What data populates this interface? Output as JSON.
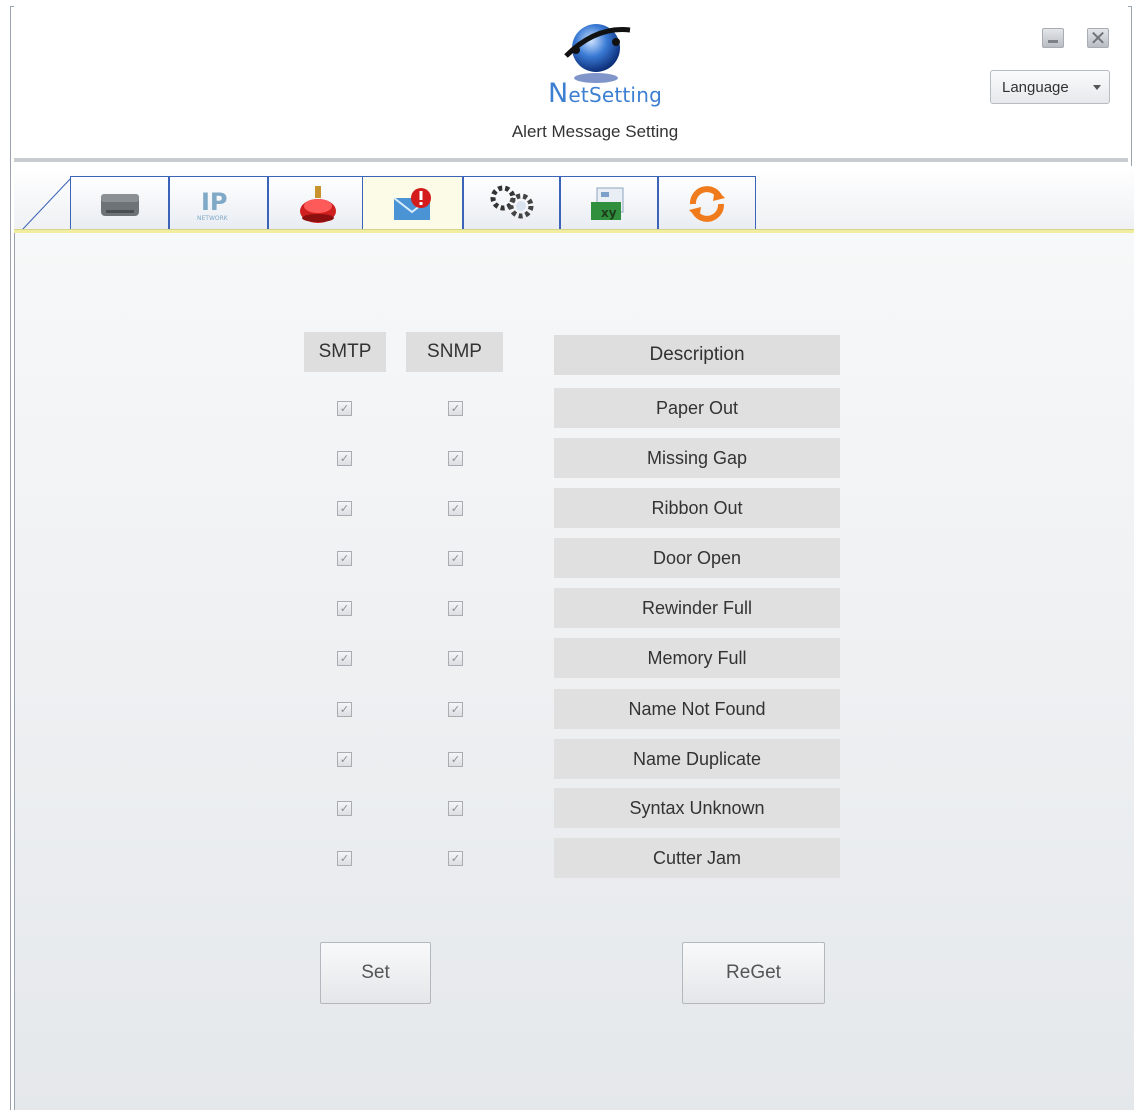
{
  "app": {
    "brand_initial": "N",
    "brand_rest": "etSetting",
    "subtitle": "Alert Message Setting"
  },
  "window": {
    "minimize_icon": "minimize-icon",
    "close_icon": "close-icon",
    "close_glyph": "✕"
  },
  "language": {
    "label": "Language"
  },
  "tabs": [
    {
      "icon": "printer-icon"
    },
    {
      "icon": "ip-network-icon",
      "text": "IP",
      "subtext": "NETWORK"
    },
    {
      "icon": "alarm-button-icon"
    },
    {
      "icon": "alert-mail-icon",
      "active": true
    },
    {
      "icon": "gears-icon"
    },
    {
      "icon": "key-card-icon",
      "text": "xy"
    },
    {
      "icon": "sync-icon"
    }
  ],
  "table": {
    "headers": {
      "smtp": "SMTP",
      "snmp": "SNMP",
      "description": "Description"
    },
    "check_glyph": "✓",
    "rows": [
      {
        "description": "Paper Out",
        "smtp": true,
        "snmp": true
      },
      {
        "description": "Missing Gap",
        "smtp": true,
        "snmp": true
      },
      {
        "description": "Ribbon Out",
        "smtp": true,
        "snmp": true
      },
      {
        "description": "Door Open",
        "smtp": true,
        "snmp": true
      },
      {
        "description": "Rewinder Full",
        "smtp": true,
        "snmp": true
      },
      {
        "description": "Memory Full",
        "smtp": true,
        "snmp": true
      },
      {
        "description": "Name Not Found",
        "smtp": true,
        "snmp": true
      },
      {
        "description": "Name Duplicate",
        "smtp": true,
        "snmp": true
      },
      {
        "description": "Syntax Unknown",
        "smtp": true,
        "snmp": true
      },
      {
        "description": "Cutter Jam",
        "smtp": true,
        "snmp": true
      }
    ]
  },
  "actions": {
    "set_label": "Set",
    "reget_label": "ReGet"
  },
  "colors": {
    "brand": "#3d7fd1",
    "tab_border": "#3b63b7",
    "active_tab": "#fbfbe8"
  }
}
